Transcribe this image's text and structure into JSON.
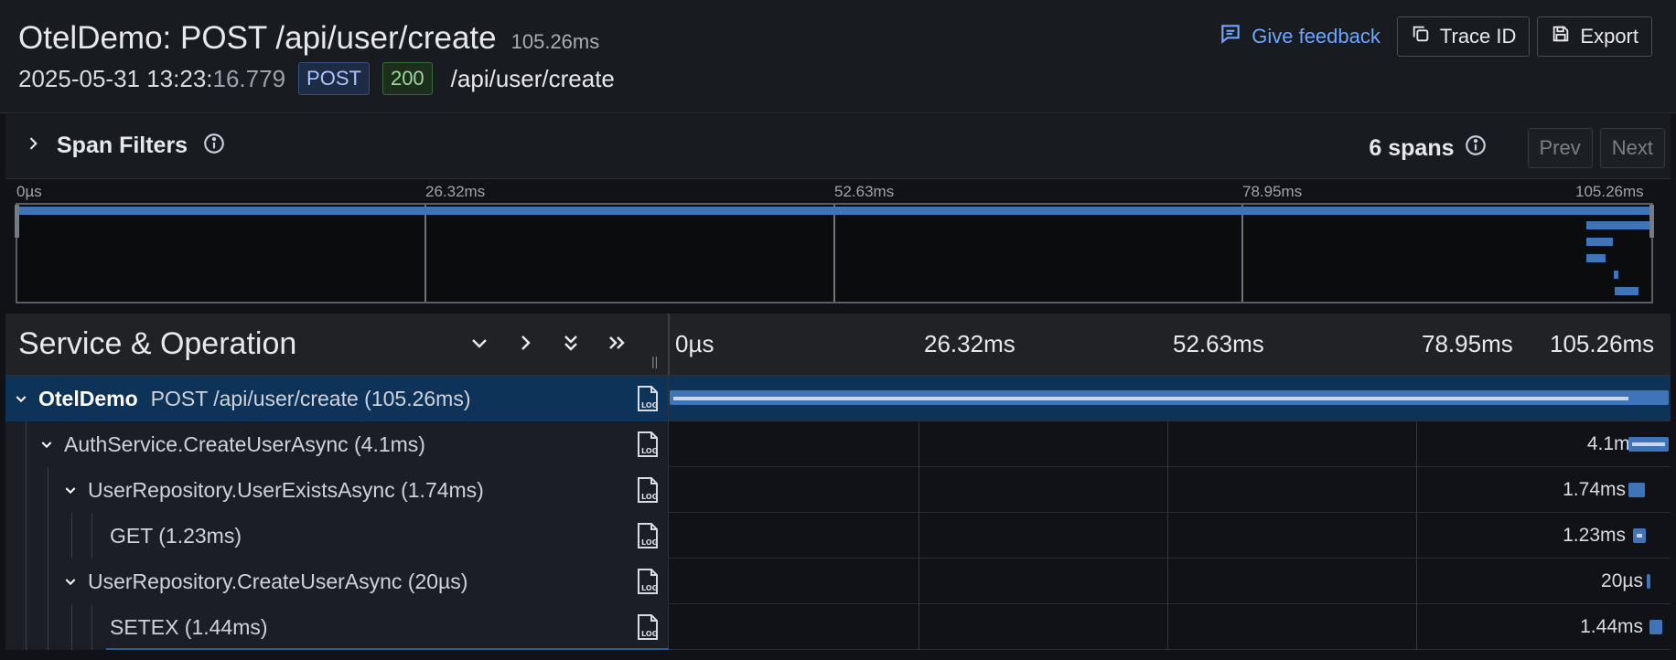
{
  "trace": {
    "service": "OtelDemo",
    "title": "OtelDemo: POST /api/user/create",
    "duration": "105.26ms",
    "timestamp_main": "2025-05-31 13:23:",
    "timestamp_ms": "16.779",
    "method": "POST",
    "status": "200",
    "route": "/api/user/create"
  },
  "actions": {
    "feedback_label": "Give feedback",
    "trace_id_label": "Trace ID",
    "export_label": "Export"
  },
  "filters": {
    "title": "Span Filters",
    "span_count": "6 spans",
    "prev_label": "Prev",
    "next_label": "Next"
  },
  "minimap": {
    "ticks": [
      "0µs",
      "26.32ms",
      "52.63ms",
      "78.95ms",
      "105.26ms"
    ]
  },
  "table": {
    "column_title": "Service & Operation",
    "timeline_ticks": [
      "0µs",
      "26.32ms",
      "52.63ms",
      "78.95ms",
      "105.26ms"
    ]
  },
  "spans": [
    {
      "service": "OtelDemo",
      "operation": "POST /api/user/create (105.26ms)",
      "duration": "105.26ms",
      "depth": 0,
      "selected": true
    },
    {
      "service": "",
      "operation": "AuthService.CreateUserAsync (4.1ms)",
      "duration": "4.1ms",
      "depth": 1
    },
    {
      "service": "",
      "operation": "UserRepository.UserExistsAsync (1.74ms)",
      "duration": "1.74ms",
      "depth": 2
    },
    {
      "service": "",
      "operation": "GET (1.23ms)",
      "duration": "1.23ms",
      "depth": 3
    },
    {
      "service": "",
      "operation": "UserRepository.CreateUserAsync (20µs)",
      "duration": "20µs",
      "depth": 2
    },
    {
      "service": "",
      "operation": "SETEX (1.44ms)",
      "duration": "1.44ms",
      "depth": 3
    }
  ],
  "colors": {
    "accent": "#6ea6ff",
    "span_bar": "#3f75b8",
    "selected_row": "#0e3359"
  }
}
